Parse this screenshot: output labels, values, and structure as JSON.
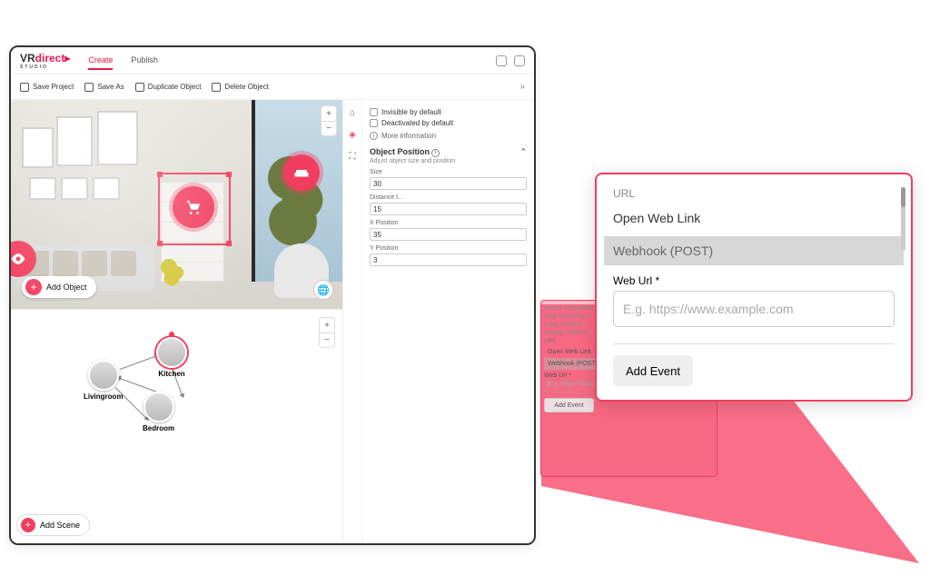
{
  "brand": {
    "name_pref": "VR",
    "name_suf": "direct",
    "sub": "STUDIO"
  },
  "tabs": {
    "create": "Create",
    "publish": "Publish"
  },
  "toolbar": {
    "save": "Save Project",
    "saveas": "Save As",
    "dup": "Duplicate Object",
    "del": "Delete Object"
  },
  "scene": {
    "add_object": "Add Object"
  },
  "graph": {
    "add_scene": "Add Scene",
    "nodes": {
      "living": "Livingroom",
      "kitchen": "Kitchen",
      "bedroom": "Bedroom"
    }
  },
  "inspector": {
    "invisible": "Invisible by default",
    "deactivated": "Deactivated by default",
    "moreinfo": "More information",
    "section": "Object Position",
    "section_sub": "Adjust object size and position",
    "size": {
      "label": "Size",
      "value": "30"
    },
    "dist": {
      "label": "Distance t…",
      "value": "15"
    },
    "xpos": {
      "label": "X Position",
      "value": "35"
    },
    "ypos": {
      "label": "Y Position",
      "value": "3"
    },
    "events": {
      "pause": "Pause Video/Sou…",
      "stop": "Stop Video/Sou…",
      "loop": "Loop Video/S…",
      "unloop": "Unloop Video/S…"
    }
  },
  "url_panel": {
    "header": "URL",
    "opt_open": "Open Web Link",
    "opt_webhook": "Webhook (POST)",
    "weburl_label": "Web Url *",
    "placeholder": "E.g. https://www.example.com",
    "add_event": "Add Event"
  }
}
